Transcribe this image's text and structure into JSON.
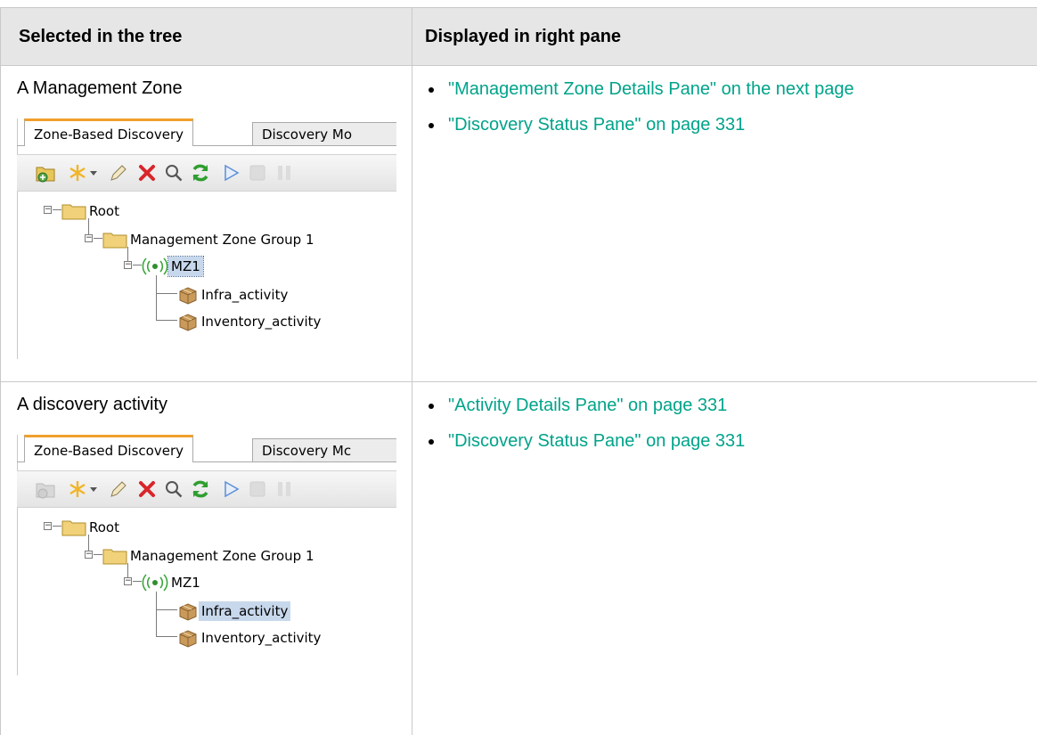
{
  "table": {
    "headers": [
      "Selected in the tree",
      "Displayed in right pane"
    ],
    "rows": [
      {
        "label": "A Management Zone",
        "links": [
          {
            "text": "\"Management Zone Details Pane\" on the next page"
          },
          {
            "text": "\"Discovery Status Pane\" on page 331"
          }
        ],
        "screenshot": {
          "tabs": [
            "Zone-Based Discovery",
            "Discovery Mo"
          ],
          "toolbar_enabled_new_folder": true,
          "tree": {
            "root": "Root",
            "group": "Management Zone Group 1",
            "zone": "MZ1",
            "activities": [
              "Infra_activity",
              "Inventory_activity"
            ],
            "selected": "MZ1"
          }
        }
      },
      {
        "label": "A discovery activity",
        "links": [
          {
            "text": "\"Activity Details Pane\" on page 331"
          },
          {
            "text": "\"Discovery Status Pane\" on page 331"
          }
        ],
        "screenshot": {
          "tabs": [
            "Zone-Based Discovery",
            "Discovery Mc"
          ],
          "toolbar_enabled_new_folder": false,
          "tree": {
            "root": "Root",
            "group": "Management Zone Group 1",
            "zone": "MZ1",
            "activities": [
              "Infra_activity",
              "Inventory_activity"
            ],
            "selected": "Infra_activity"
          }
        }
      }
    ]
  },
  "icons": [
    "new-folder-icon",
    "new-star-icon",
    "dropdown-arrow-icon",
    "edit-pencil-icon",
    "delete-x-icon",
    "search-icon",
    "refresh-icon",
    "play-icon",
    "stop-icon",
    "pause-icon",
    "folder-icon",
    "zone-signal-icon",
    "activity-box-icon"
  ],
  "colors": {
    "link": "#00a38a",
    "header_bg": "#e6e6e6",
    "tab_accent": "#f0a02c",
    "selection": "#c8d8ec"
  }
}
